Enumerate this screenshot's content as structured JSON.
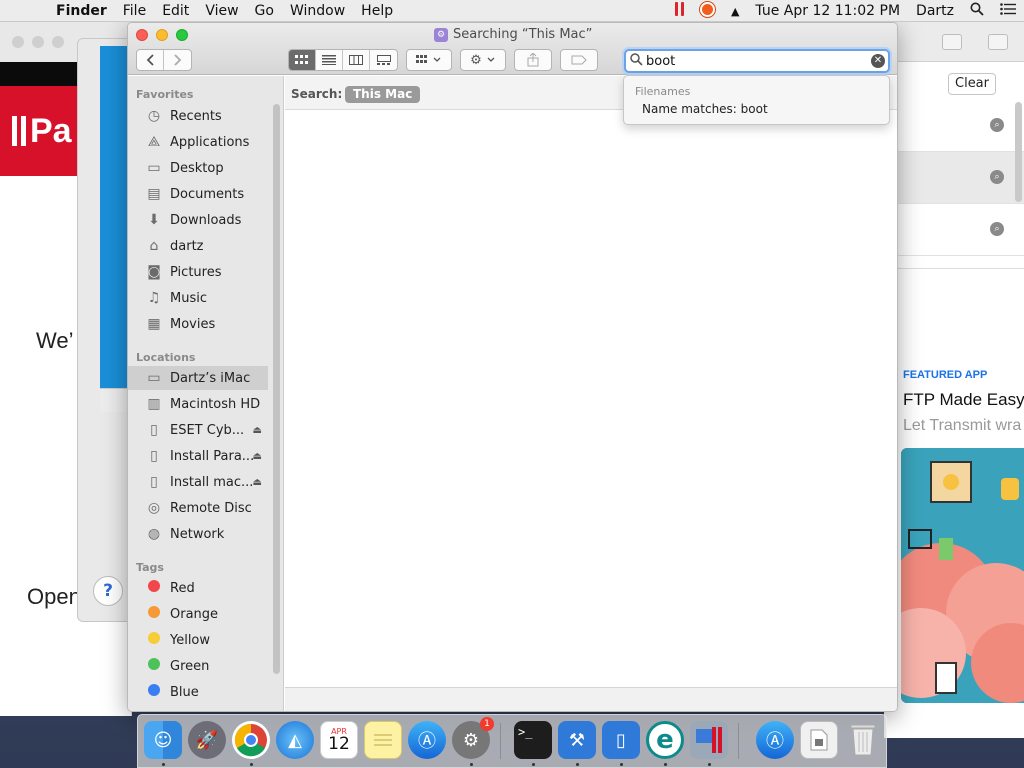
{
  "menubar": {
    "apple_icon": "apple-icon",
    "app_name": "Finder",
    "items": [
      "File",
      "Edit",
      "View",
      "Go",
      "Window",
      "Help"
    ],
    "datetime": "Tue Apr 12  11:02 PM",
    "user": "Dartz",
    "status_icons": [
      "parallels-icon",
      "firefox-status-icon",
      "eject-icon",
      "spotlight-icon",
      "notification-center-icon"
    ]
  },
  "background": {
    "parallels_text_1": "We’",
    "parallels_text_2": "Open",
    "parallels_logo_text": "Pa",
    "help_label": "?",
    "store_clear": "Clear",
    "store_featured": "FEATURED APP",
    "store_title": "FTP Made Easy",
    "store_subtitle": "Let Transmit wra"
  },
  "finder": {
    "window_title": "Searching “This Mac”",
    "search": {
      "value": "boot",
      "placeholder": "Search"
    },
    "scope_label": "Search:",
    "scope_value": "This Mac",
    "dropdown": {
      "header": "Filenames",
      "item": "Name matches: boot"
    },
    "sidebar": {
      "favorites_header": "Favorites",
      "favorites": [
        {
          "label": "Recents",
          "icon": "clock-icon"
        },
        {
          "label": "Applications",
          "icon": "applications-icon"
        },
        {
          "label": "Desktop",
          "icon": "desktop-icon"
        },
        {
          "label": "Documents",
          "icon": "document-icon"
        },
        {
          "label": "Downloads",
          "icon": "download-icon"
        },
        {
          "label": "dartz",
          "icon": "home-icon"
        },
        {
          "label": "Pictures",
          "icon": "camera-icon"
        },
        {
          "label": "Music",
          "icon": "music-icon"
        },
        {
          "label": "Movies",
          "icon": "film-icon"
        }
      ],
      "locations_header": "Locations",
      "locations": [
        {
          "label": "Dartz’s iMac",
          "icon": "imac-icon"
        },
        {
          "label": "Macintosh HD",
          "icon": "hard-drive-icon"
        },
        {
          "label": "ESET Cyb...",
          "icon": "disk-icon"
        },
        {
          "label": "Install Para...",
          "icon": "disk-icon"
        },
        {
          "label": "Install mac...",
          "icon": "disk-icon"
        },
        {
          "label": "Remote Disc",
          "icon": "disc-icon"
        },
        {
          "label": "Network",
          "icon": "globe-icon"
        }
      ],
      "tags_header": "Tags",
      "tags": [
        {
          "label": "Red",
          "color": "#f2474a"
        },
        {
          "label": "Orange",
          "color": "#f59a36"
        },
        {
          "label": "Yellow",
          "color": "#f6cd34"
        },
        {
          "label": "Green",
          "color": "#4dc25a"
        },
        {
          "label": "Blue",
          "color": "#3a7ef2"
        }
      ]
    }
  },
  "dock": {
    "apps": [
      "finder-icon",
      "launchpad-icon",
      "chrome-icon",
      "safari-icon",
      "calendar-icon",
      "notes-icon",
      "app-store-icon",
      "system-preferences-icon",
      "terminal-icon",
      "xcode-icon",
      "simulator-icon",
      "eset-icon",
      "parallels-icon",
      "app-store-download-icon",
      "document-icon",
      "trash-icon"
    ],
    "calendar_month": "APR",
    "calendar_day": "12",
    "system_prefs_badge": "1",
    "terminal_text": ">_"
  }
}
